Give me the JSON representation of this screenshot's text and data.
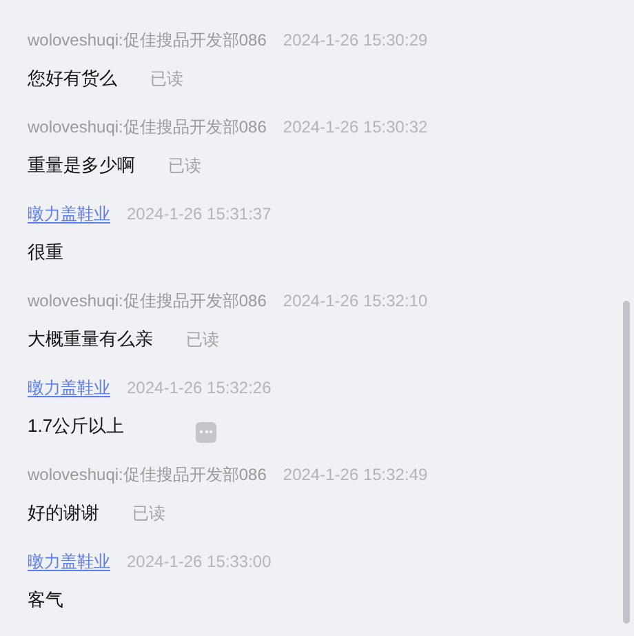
{
  "messages": [
    {
      "kind": "customer",
      "sender": "woloveshuqi:促佳搜品开发部086",
      "time": "2024-1-26 15:30:29",
      "text": "您好有货么",
      "status": "已读",
      "menu_button": false
    },
    {
      "kind": "customer",
      "sender": "woloveshuqi:促佳搜品开发部086",
      "time": "2024-1-26 15:30:32",
      "text": "重量是多少啊",
      "status": "已读",
      "menu_button": false
    },
    {
      "kind": "shop",
      "sender": "暾力盖鞋业",
      "time": "2024-1-26 15:31:37",
      "text": "很重",
      "menu_button": false
    },
    {
      "kind": "customer",
      "sender": "woloveshuqi:促佳搜品开发部086",
      "time": "2024-1-26 15:32:10",
      "text": "大概重量有么亲",
      "status": "已读",
      "menu_button": false
    },
    {
      "kind": "shop",
      "sender": "暾力盖鞋业",
      "time": "2024-1-26 15:32:26",
      "text": "1.7公斤以上",
      "menu_button": true
    },
    {
      "kind": "customer",
      "sender": "woloveshuqi:促佳搜品开发部086",
      "time": "2024-1-26 15:32:49",
      "text": "好的谢谢",
      "status": "已读",
      "menu_button": false
    },
    {
      "kind": "shop",
      "sender": "暾力盖鞋业",
      "time": "2024-1-26 15:33:00",
      "text": "客气",
      "menu_button": false
    }
  ]
}
